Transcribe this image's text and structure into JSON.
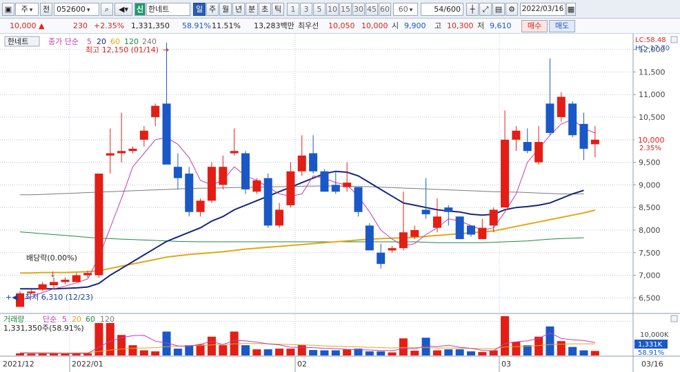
{
  "toolbar": {
    "period_select": "주",
    "prev_label": "전",
    "code_value": "052600",
    "search_label": "Q",
    "sin_badge": "신",
    "stock_name": "한네트",
    "period_buttons": [
      "일",
      "주",
      "월",
      "년",
      "분",
      "초",
      "틱"
    ],
    "active_period": "일",
    "number_buttons": [
      "1",
      "3",
      "5",
      "10",
      "15",
      "30",
      "45",
      "60"
    ],
    "interval_value": "60",
    "count_value": "54",
    "count_total": "/600",
    "date_value": "2022/03/16"
  },
  "infobar": {
    "price": "10,000",
    "change": "230",
    "change_pct": "+2.35%",
    "volume": "1,331,350",
    "volume_ratio": "58.91%",
    "turnover": "11.51%",
    "trade_amount": "13,283백만",
    "best_ask_label": "최우선",
    "best_ask": "10,050",
    "best_bid": "10,000",
    "open_label": "시",
    "open": "9,900",
    "high_label": "고",
    "high": "10,300",
    "low_label": "저",
    "low": "9,610",
    "buy_label": "매수",
    "sell_label": "매도"
  },
  "chart_panel": {
    "name_tag": "한네트",
    "legend_prefix": "종가 단순",
    "ma_periods": [
      "5",
      "20",
      "60",
      "120",
      "240"
    ],
    "high_note": "최고 12,150 (01/14)",
    "low_note": "최저 6,310 (12/23)",
    "dividend_note": "배당락(0.00%)",
    "lc_label": "LC:58.48",
    "hc_label": "HC:-17.70",
    "price_tag": "10,000",
    "pct_tag": "2.35%"
  },
  "volume_panel": {
    "title": "거래량",
    "legend_prefix": "단순",
    "ma_periods": [
      "5",
      "20",
      "60",
      "120"
    ],
    "current_note": "1,331,350주(58.91%)",
    "vol_tag": "1,331K",
    "pct_tag": "58.91%",
    "axis_label": "10,000K"
  },
  "date_axis": [
    "2021/12",
    "2022/01",
    "02",
    "03",
    "03/16"
  ],
  "colors": {
    "up": "#e41e15",
    "down": "#1a58c8",
    "ma5": "#c23bb5",
    "ma20": "#15257a",
    "ma60": "#e0a816",
    "ma120": "#1c8a3e",
    "ma240": "#7a7a7a"
  },
  "chart_data": {
    "type": "candlestick",
    "ylim": [
      6200,
      12300
    ],
    "y_ticks": [
      6500,
      7000,
      7500,
      8000,
      8500,
      9000,
      9500,
      10000,
      10500,
      11000,
      11500,
      12000
    ],
    "candles": [
      {
        "o": 6300,
        "h": 6650,
        "l": 6310,
        "c": 6600
      },
      {
        "o": 6600,
        "h": 6680,
        "l": 6580,
        "c": 6640
      },
      {
        "o": 6680,
        "h": 6850,
        "l": 6650,
        "c": 6800
      },
      {
        "o": 6780,
        "h": 6950,
        "l": 6700,
        "c": 6850
      },
      {
        "o": 6850,
        "h": 6950,
        "l": 6800,
        "c": 6900
      },
      {
        "o": 6850,
        "h": 7050,
        "l": 6850,
        "c": 7000
      },
      {
        "o": 7000,
        "h": 7100,
        "l": 6950,
        "c": 7050
      },
      {
        "o": 7000,
        "h": 9250,
        "l": 6950,
        "c": 9250
      },
      {
        "o": 9650,
        "h": 10250,
        "l": 9250,
        "c": 9700
      },
      {
        "o": 9700,
        "h": 10600,
        "l": 9500,
        "c": 9750
      },
      {
        "o": 9750,
        "h": 9850,
        "l": 9700,
        "c": 9800
      },
      {
        "o": 10000,
        "h": 10300,
        "l": 9850,
        "c": 10200
      },
      {
        "o": 10500,
        "h": 10800,
        "l": 10300,
        "c": 10750
      },
      {
        "o": 10800,
        "h": 12150,
        "l": 9500,
        "c": 9450
      },
      {
        "o": 9400,
        "h": 9700,
        "l": 8900,
        "c": 9150
      },
      {
        "o": 9250,
        "h": 9400,
        "l": 8300,
        "c": 8400
      },
      {
        "o": 8400,
        "h": 8700,
        "l": 8300,
        "c": 8650
      },
      {
        "o": 8650,
        "h": 9500,
        "l": 8600,
        "c": 9400
      },
      {
        "o": 9000,
        "h": 9650,
        "l": 8900,
        "c": 9400
      },
      {
        "o": 9700,
        "h": 10250,
        "l": 9650,
        "c": 9750
      },
      {
        "o": 9700,
        "h": 9750,
        "l": 8800,
        "c": 8900
      },
      {
        "o": 8850,
        "h": 9150,
        "l": 8800,
        "c": 9100
      },
      {
        "o": 9150,
        "h": 9250,
        "l": 8050,
        "c": 8100
      },
      {
        "o": 8100,
        "h": 8600,
        "l": 8050,
        "c": 8450
      },
      {
        "o": 8550,
        "h": 9500,
        "l": 8500,
        "c": 9300
      },
      {
        "o": 9300,
        "h": 10100,
        "l": 9200,
        "c": 9650
      },
      {
        "o": 9700,
        "h": 10100,
        "l": 9250,
        "c": 9300
      },
      {
        "o": 9300,
        "h": 9350,
        "l": 8850,
        "c": 8850
      },
      {
        "o": 9000,
        "h": 9300,
        "l": 8800,
        "c": 8850
      },
      {
        "o": 8950,
        "h": 9500,
        "l": 8850,
        "c": 9050
      },
      {
        "o": 8950,
        "h": 8950,
        "l": 8300,
        "c": 8400
      },
      {
        "o": 8100,
        "h": 8150,
        "l": 7600,
        "c": 7550
      },
      {
        "o": 7500,
        "h": 7700,
        "l": 7150,
        "c": 7250
      },
      {
        "o": 7550,
        "h": 7650,
        "l": 7500,
        "c": 7600
      },
      {
        "o": 7600,
        "h": 8850,
        "l": 7550,
        "c": 7950
      },
      {
        "o": 7850,
        "h": 8100,
        "l": 7800,
        "c": 8000
      },
      {
        "o": 8450,
        "h": 9150,
        "l": 8250,
        "c": 8350
      },
      {
        "o": 8050,
        "h": 8700,
        "l": 7950,
        "c": 8300
      },
      {
        "o": 8500,
        "h": 8550,
        "l": 8100,
        "c": 8400
      },
      {
        "o": 8300,
        "h": 8300,
        "l": 7800,
        "c": 7800
      },
      {
        "o": 8100,
        "h": 8100,
        "l": 7850,
        "c": 7900
      },
      {
        "o": 7800,
        "h": 8250,
        "l": 7800,
        "c": 8050
      },
      {
        "o": 8100,
        "h": 8500,
        "l": 7950,
        "c": 8450
      },
      {
        "o": 8500,
        "h": 10650,
        "l": 8500,
        "c": 10000
      },
      {
        "o": 10000,
        "h": 10300,
        "l": 9750,
        "c": 10200
      },
      {
        "o": 9950,
        "h": 10250,
        "l": 9700,
        "c": 9750
      },
      {
        "o": 9500,
        "h": 10300,
        "l": 9450,
        "c": 9950
      },
      {
        "o": 10800,
        "h": 11800,
        "l": 10100,
        "c": 10150
      },
      {
        "o": 10500,
        "h": 11050,
        "l": 10400,
        "c": 10950
      },
      {
        "o": 10800,
        "h": 10850,
        "l": 10050,
        "c": 10100
      },
      {
        "o": 10350,
        "h": 10600,
        "l": 9550,
        "c": 9800
      },
      {
        "o": 9900,
        "h": 10300,
        "l": 9610,
        "c": 10000
      }
    ],
    "ma5": [
      6450,
      6520,
      6620,
      6700,
      6760,
      6830,
      6920,
      7400,
      8050,
      8700,
      9400,
      9700,
      10000,
      10050,
      9900,
      9600,
      9100,
      9000,
      9100,
      9400,
      9200,
      9100,
      8950,
      8800,
      8750,
      8800,
      9200,
      9150,
      9050,
      9000,
      8750,
      8400,
      8000,
      7800,
      7650,
      7700,
      7900,
      8050,
      8250,
      8200,
      8100,
      8000,
      8050,
      8400,
      8800,
      9500,
      9800,
      10100,
      10350,
      10450,
      10250,
      10150
    ],
    "ma20": [
      6700,
      6700,
      6700,
      6700,
      6710,
      6720,
      6740,
      6820,
      7000,
      7150,
      7300,
      7450,
      7600,
      7750,
      7850,
      7950,
      8050,
      8200,
      8300,
      8450,
      8550,
      8650,
      8750,
      8850,
      8950,
      9050,
      9150,
      9250,
      9300,
      9280,
      9200,
      9050,
      8900,
      8750,
      8600,
      8550,
      8500,
      8450,
      8420,
      8400,
      8350,
      8330,
      8350,
      8450,
      8500,
      8520,
      8550,
      8600,
      8700,
      8800,
      8880
    ],
    "ma60": [
      7050,
      7050,
      7060,
      7060,
      7060,
      7070,
      7080,
      7100,
      7150,
      7200,
      7250,
      7300,
      7350,
      7400,
      7430,
      7460,
      7480,
      7500,
      7520,
      7550,
      7580,
      7600,
      7620,
      7640,
      7660,
      7680,
      7700,
      7720,
      7740,
      7760,
      7780,
      7800,
      7810,
      7820,
      7830,
      7840,
      7860,
      7880,
      7900,
      7920,
      7940,
      7960,
      7980,
      8030,
      8080,
      8130,
      8180,
      8230,
      8280,
      8330,
      8380,
      8440
    ],
    "ma120": [
      7960,
      7940,
      7920,
      7900,
      7880,
      7860,
      7840,
      7820,
      7810,
      7800,
      7790,
      7780,
      7770,
      7760,
      7750,
      7745,
      7740,
      7740,
      7740,
      7740,
      7740,
      7740,
      7740,
      7740,
      7740,
      7740,
      7740,
      7740,
      7740,
      7740,
      7740,
      7740,
      7740,
      7740,
      7740,
      7740,
      7730,
      7720,
      7720,
      7720,
      7720,
      7720,
      7730,
      7740,
      7750,
      7760,
      7780,
      7800,
      7810,
      7820,
      7830
    ],
    "ma240": [
      8780,
      8780,
      8790,
      8800,
      8810,
      8820,
      8830,
      8840,
      8850,
      8860,
      8870,
      8880,
      8890,
      8900,
      8910,
      8920,
      8925,
      8930,
      8935,
      8940,
      8945,
      8950,
      8955,
      8960,
      8965,
      8970,
      8972,
      8975,
      8975,
      8970,
      8965,
      8960,
      8950,
      8940,
      8930,
      8920,
      8910,
      8900,
      8890,
      8880,
      8870,
      8860,
      8850,
      8845,
      8840,
      8830,
      8820,
      8810,
      8800,
      8800,
      8800
    ],
    "volume": {
      "ylim": [
        0,
        11500
      ],
      "y_ticks": [
        10000
      ],
      "values": [
        600,
        500,
        550,
        600,
        500,
        700,
        650,
        9500,
        9500,
        6000,
        3000,
        1500,
        1200,
        7000,
        2000,
        3000,
        3200,
        5500,
        3000,
        7000,
        3000,
        1800,
        1800,
        2000,
        2000,
        3000,
        1600,
        1500,
        1500,
        1800,
        2000,
        1200,
        1200,
        900,
        5000,
        1400,
        5200,
        1500,
        1800,
        1800,
        1200,
        1000,
        1500,
        12000,
        4000,
        3000,
        5500,
        8500,
        4200,
        2500,
        1500,
        1331
      ],
      "ma5": [
        700,
        650,
        620,
        600,
        560,
        580,
        620,
        2400,
        4200,
        5200,
        5800,
        5900,
        4200,
        3700,
        2800,
        2700,
        3300,
        4100,
        3200,
        4400,
        4300,
        3900,
        3400,
        3100,
        2400,
        2400,
        2300,
        2100,
        2000,
        1800,
        1700,
        1600,
        1500,
        1400,
        2000,
        2000,
        2700,
        2600,
        3000,
        2400,
        2100,
        1500,
        1400,
        3500,
        4000,
        4300,
        5000,
        6600,
        5000,
        4600,
        4400,
        3800
      ],
      "ma20": [
        800,
        800,
        800,
        780,
        760,
        760,
        800,
        1200,
        1600,
        1900,
        2100,
        2200,
        2300,
        2600,
        2700,
        2800,
        2900,
        3100,
        3200,
        3400,
        3500,
        3500,
        3400,
        3300,
        3200,
        3100,
        3000,
        2800,
        2700,
        2600,
        2500,
        2400,
        2300,
        2200,
        2300,
        2300,
        2300,
        2200,
        2200,
        2100,
        2100,
        2000,
        2000,
        2500,
        2600,
        2700,
        2900,
        3200,
        3300,
        3400,
        3400,
        3400
      ]
    }
  }
}
